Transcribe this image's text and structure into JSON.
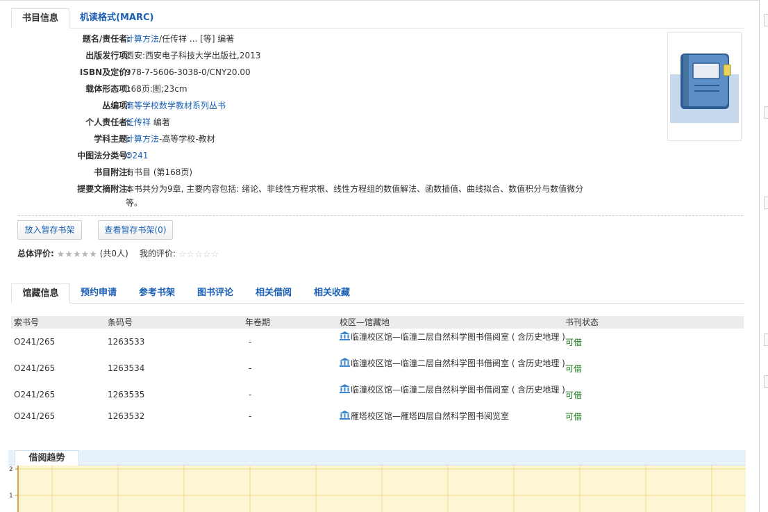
{
  "top_tabs": [
    {
      "label": "书目信息",
      "active": true
    },
    {
      "label": "机读格式(MARC)",
      "active": false
    }
  ],
  "record": {
    "title_label": "题名/责任者:",
    "title_link": "计算方法",
    "title_rest": "/任传祥 ... [等] 编著",
    "publish_label": "出版发行项:",
    "publish_value": "西安:西安电子科技大学出版社,2013",
    "isbn_label": "ISBN及定价:",
    "isbn_value": "978-7-5606-3038-0/CNY20.00",
    "physical_label": "载体形态项:",
    "physical_value": "168页:图;23cm",
    "series_label": "丛编项:",
    "series_link": "高等学校数学教材系列丛书",
    "person_label": "个人责任者:",
    "person_link": "任传祥",
    "person_rest": " 编著",
    "subject_label": "学科主题:",
    "subject_link": "计算方法",
    "subject_rest": "-高等学校-教材",
    "clc_label": "中图法分类号:",
    "clc_link": "O241",
    "note_label": "书目附注:",
    "note_value": "有书目 (第168页)",
    "abstract_label": "提要文摘附注:",
    "abstract_value": "本书共分为9章, 主要内容包括: 绪论、非线性方程求根、线性方程组的数值解法、函数插值、曲线拟合、数值积分与数值微分等。"
  },
  "cover": {
    "icon": "book-cover-icon"
  },
  "buttons": {
    "add_shelf": "放入暂存书架",
    "view_shelf": "查看暂存书架(0)"
  },
  "rating": {
    "overall_label": "总体评价:",
    "overall_count": "(共0人)",
    "overall_stars": 0,
    "my_label": "我的评价:",
    "my_stars": 0
  },
  "holding_tabs": [
    {
      "label": "馆藏信息",
      "active": true
    },
    {
      "label": "预约申请",
      "active": false
    },
    {
      "label": "参考书架",
      "active": false
    },
    {
      "label": "图书评论",
      "active": false
    },
    {
      "label": "相关借阅",
      "active": false
    },
    {
      "label": "相关收藏",
      "active": false
    }
  ],
  "holdings": {
    "headers": [
      "索书号",
      "条码号",
      "年卷期",
      "校区—馆藏地",
      "书刊状态"
    ],
    "rows": [
      {
        "call_no": "O241/265",
        "barcode": "1263533",
        "volume": "-",
        "location": "临潼校区馆—临潼二层自然科学图书借阅室 ( 含历史地理 )",
        "status": "可借"
      },
      {
        "call_no": "O241/265",
        "barcode": "1263534",
        "volume": "-",
        "location": "临潼校区馆—临潼二层自然科学图书借阅室 ( 含历史地理 )",
        "status": "可借"
      },
      {
        "call_no": "O241/265",
        "barcode": "1263535",
        "volume": "-",
        "location": "临潼校区馆—临潼二层自然科学图书借阅室 ( 含历史地理 )",
        "status": "可借"
      },
      {
        "call_no": "O241/265",
        "barcode": "1263532",
        "volume": "-",
        "location": "雁塔校区馆—雁塔四层自然科学图书阅览室",
        "status": "可借"
      }
    ]
  },
  "trend": {
    "tab_label": "借阅趋势",
    "y_ticks": [
      "2",
      "1"
    ]
  },
  "colors": {
    "link": "#1a5fb4",
    "available": "#1a7a1a",
    "chart_bg": "#fdf6d2",
    "chart_grid": "#f0d98a",
    "library_icon": "#3a86d0"
  }
}
